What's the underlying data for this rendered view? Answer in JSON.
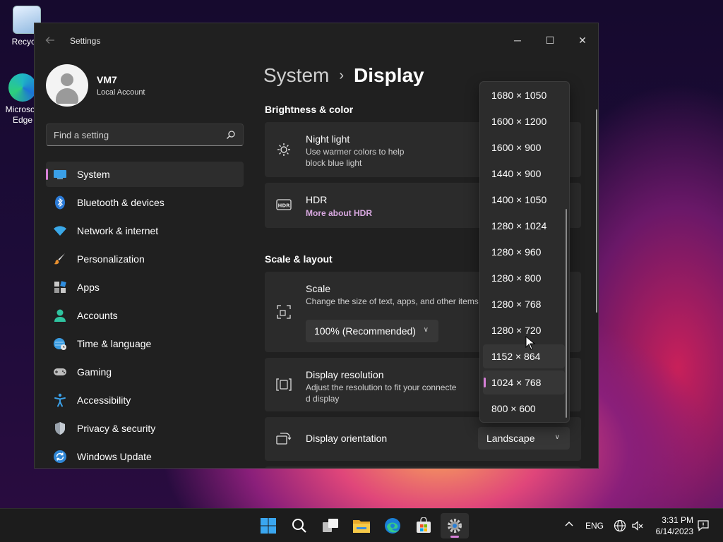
{
  "desktop": {
    "icons": [
      {
        "label": "Recycle"
      },
      {
        "label": "Microsoft Edge"
      }
    ]
  },
  "window": {
    "title": "Settings",
    "caption": {
      "minimize": "─",
      "maximize": "☐",
      "close": "✕"
    }
  },
  "profile": {
    "name": "VM7",
    "account_type": "Local Account"
  },
  "search": {
    "placeholder": "Find a setting"
  },
  "sidebar": {
    "items": [
      {
        "label": "System",
        "icon": "monitor-icon",
        "selected": true
      },
      {
        "label": "Bluetooth & devices",
        "icon": "bluetooth-icon"
      },
      {
        "label": "Network & internet",
        "icon": "wifi-icon"
      },
      {
        "label": "Personalization",
        "icon": "brush-icon"
      },
      {
        "label": "Apps",
        "icon": "apps-icon"
      },
      {
        "label": "Accounts",
        "icon": "person-icon"
      },
      {
        "label": "Time & language",
        "icon": "globe-clock-icon"
      },
      {
        "label": "Gaming",
        "icon": "gamepad-icon"
      },
      {
        "label": "Accessibility",
        "icon": "accessibility-icon"
      },
      {
        "label": "Privacy & security",
        "icon": "shield-icon"
      },
      {
        "label": "Windows Update",
        "icon": "update-icon"
      }
    ]
  },
  "breadcrumb": {
    "parent": "System",
    "separator": "›",
    "current": "Display"
  },
  "sections": {
    "brightness": "Brightness & color",
    "scale_layout": "Scale & layout"
  },
  "cards": {
    "night_light": {
      "title": "Night light",
      "desc_line1": "Use warmer colors to help",
      "desc_line2": "block blue light"
    },
    "hdr": {
      "title": "HDR",
      "link": "More about HDR"
    },
    "scale": {
      "title": "Scale",
      "desc": "Change the size of text, apps, and other items",
      "value": "100% (Recommended)"
    },
    "resolution": {
      "title": "Display resolution",
      "desc_line1": "Adjust the resolution to fit your connecte",
      "desc_line2": "d display"
    },
    "orientation": {
      "title": "Display orientation",
      "value": "Landscape"
    }
  },
  "resolution_options": [
    "1680 × 1050",
    "1600 × 1200",
    "1600 × 900",
    "1440 × 900",
    "1400 × 1050",
    "1280 × 1024",
    "1280 × 960",
    "1280 × 800",
    "1280 × 768",
    "1280 × 720",
    "1152 × 864",
    "1024 × 768",
    "800 × 600"
  ],
  "resolution_selected": "1024 × 768",
  "resolution_hovered": "1152 × 864",
  "taskbar": {
    "apps": [
      "start-icon",
      "search-icon",
      "task-view-icon",
      "file-explorer-icon",
      "edge-icon",
      "store-icon",
      "settings-icon"
    ],
    "tray_chevron": "^",
    "language": "ENG",
    "time": "3:31 PM",
    "date": "6/14/2023"
  },
  "colors": {
    "accent": "#d67fd7",
    "window_bg": "#202020",
    "card_bg": "#2b2b2b"
  }
}
